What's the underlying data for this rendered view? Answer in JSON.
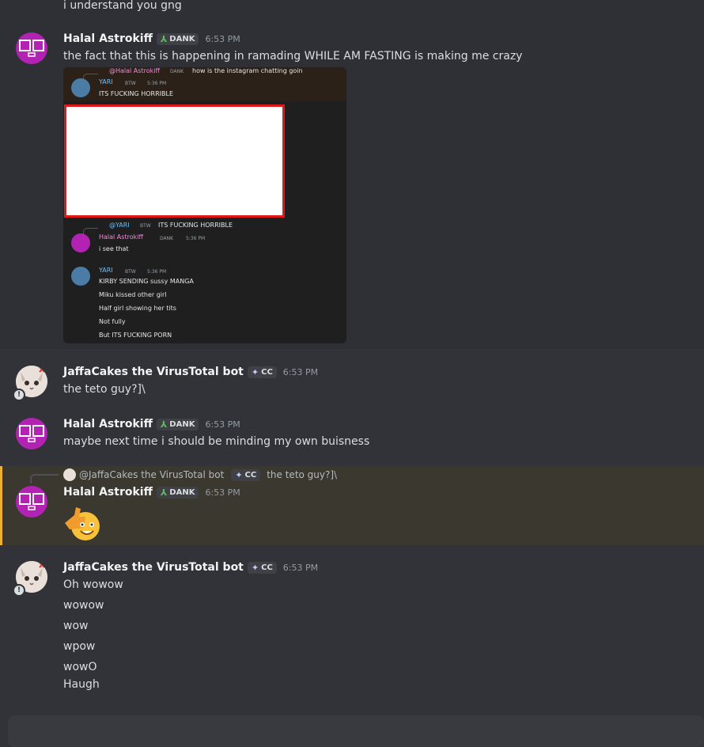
{
  "prev_message": {
    "text": "i understand you gng"
  },
  "msg1": {
    "author": "Halal Astrokiff",
    "tag": "DANK",
    "time": "6:53 PM",
    "text": "the fact that this is happening in ramading WHILE AM FASTING is making me crazy"
  },
  "screenshot": {
    "reply_mention": "@Halal Astrokiff",
    "reply_tag": "DANK",
    "reply_text": "how is the instagram chatting goin",
    "yari_name": "YARI",
    "yari_tag": "BTW",
    "yari_time": "5:36 PM",
    "yari_text1": "ITS FUCKING HORRIBLE",
    "reply2_mention": "@YARI",
    "reply2_tag": "BTW",
    "reply2_text": "ITS FUCKING HORRIBLE",
    "halal_name": "Halal Astrokiff",
    "halal_tag": "DANK",
    "halal_time": "5:36 PM",
    "halal_text": "i see that",
    "yari2_name": "YARI",
    "yari2_tag": "BTW",
    "yari2_time": "5:36 PM",
    "yari2_lines": [
      "KIRBY SENDING sussy MANGA",
      "Miku kissed other girl",
      "Half girl showing her tits",
      "Not fully",
      "But ITS FUCKING PORN"
    ]
  },
  "msg2": {
    "author": "JaffaCakes the VirusTotal bot",
    "tag": "CC",
    "time": "6:53 PM",
    "text": "the teto guy?]\\"
  },
  "msg3": {
    "author": "Halal Astrokiff",
    "tag": "DANK",
    "time": "6:53 PM",
    "text": "maybe next time i should be minding my own buisness"
  },
  "msg4": {
    "reply_author": "@JaffaCakes the VirusTotal bot",
    "reply_tag": "CC",
    "reply_text": "the teto guy?]\\",
    "author": "Halal Astrokiff",
    "tag": "DANK",
    "time": "6:53 PM",
    "emoji": "thumbs-up-face-emoji"
  },
  "msg5": {
    "author": "JaffaCakes the VirusTotal bot",
    "tag": "CC",
    "time": "6:53 PM",
    "lines": [
      "Oh wowow",
      "wowow",
      "wow",
      "wpow",
      "wowO",
      "Haugh"
    ]
  },
  "colors": {
    "background": "#313338",
    "mention_highlight": "#3a382f",
    "mention_bar": "#f0b132",
    "dank_icon": "#57c55b",
    "halal_avatar": "#b323b3"
  }
}
